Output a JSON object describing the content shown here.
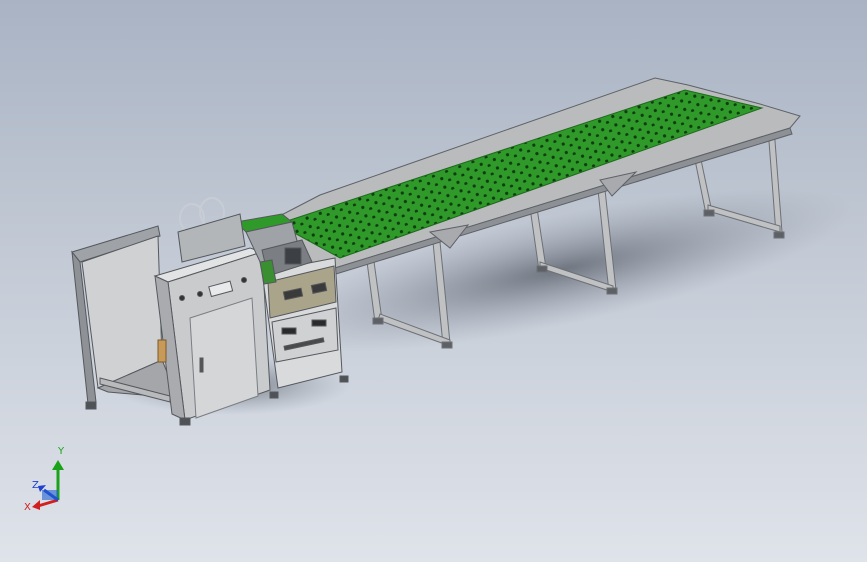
{
  "viewport": {
    "background_top": "#a9b3c4",
    "background_bottom": "#dfe3ea"
  },
  "model": {
    "belt_color": "#2f9a2a",
    "frame_color": "#b9bbbd",
    "cabinet_color": "#c9cbcd",
    "panel_color": "#a9a48a"
  },
  "triad": {
    "y_label": "Y",
    "z_label": "Z",
    "x_label": "X",
    "y_color": "#1aa31a",
    "z_color": "#2040d0",
    "x_color": "#d02020"
  }
}
